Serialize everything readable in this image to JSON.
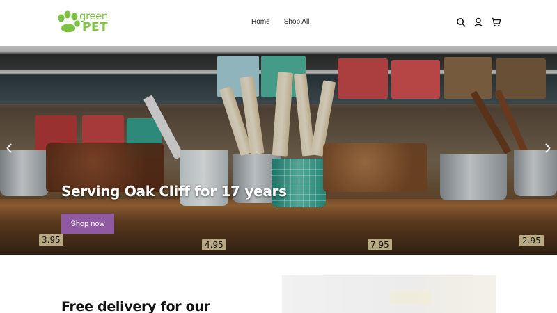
{
  "brand": {
    "logo_line1": "green",
    "logo_line2": "PET",
    "accent_color": "#7dc242",
    "icon": "paw-icon"
  },
  "nav": {
    "items": [
      {
        "label": "Home"
      },
      {
        "label": "Shop All"
      }
    ]
  },
  "header_icons": {
    "search": "search-icon",
    "account": "account-icon",
    "cart": "cart-icon"
  },
  "hero": {
    "title": "Serving Oak Cliff for 17 years",
    "button_label": "Shop now",
    "button_color": "#8f5aa2",
    "prev_icon": "chevron-left-icon",
    "next_icon": "chevron-right-icon",
    "price_tags": [
      "3.95",
      "4.95",
      "7.95",
      "2.95"
    ]
  },
  "promo": {
    "title": "Free delivery for our"
  }
}
